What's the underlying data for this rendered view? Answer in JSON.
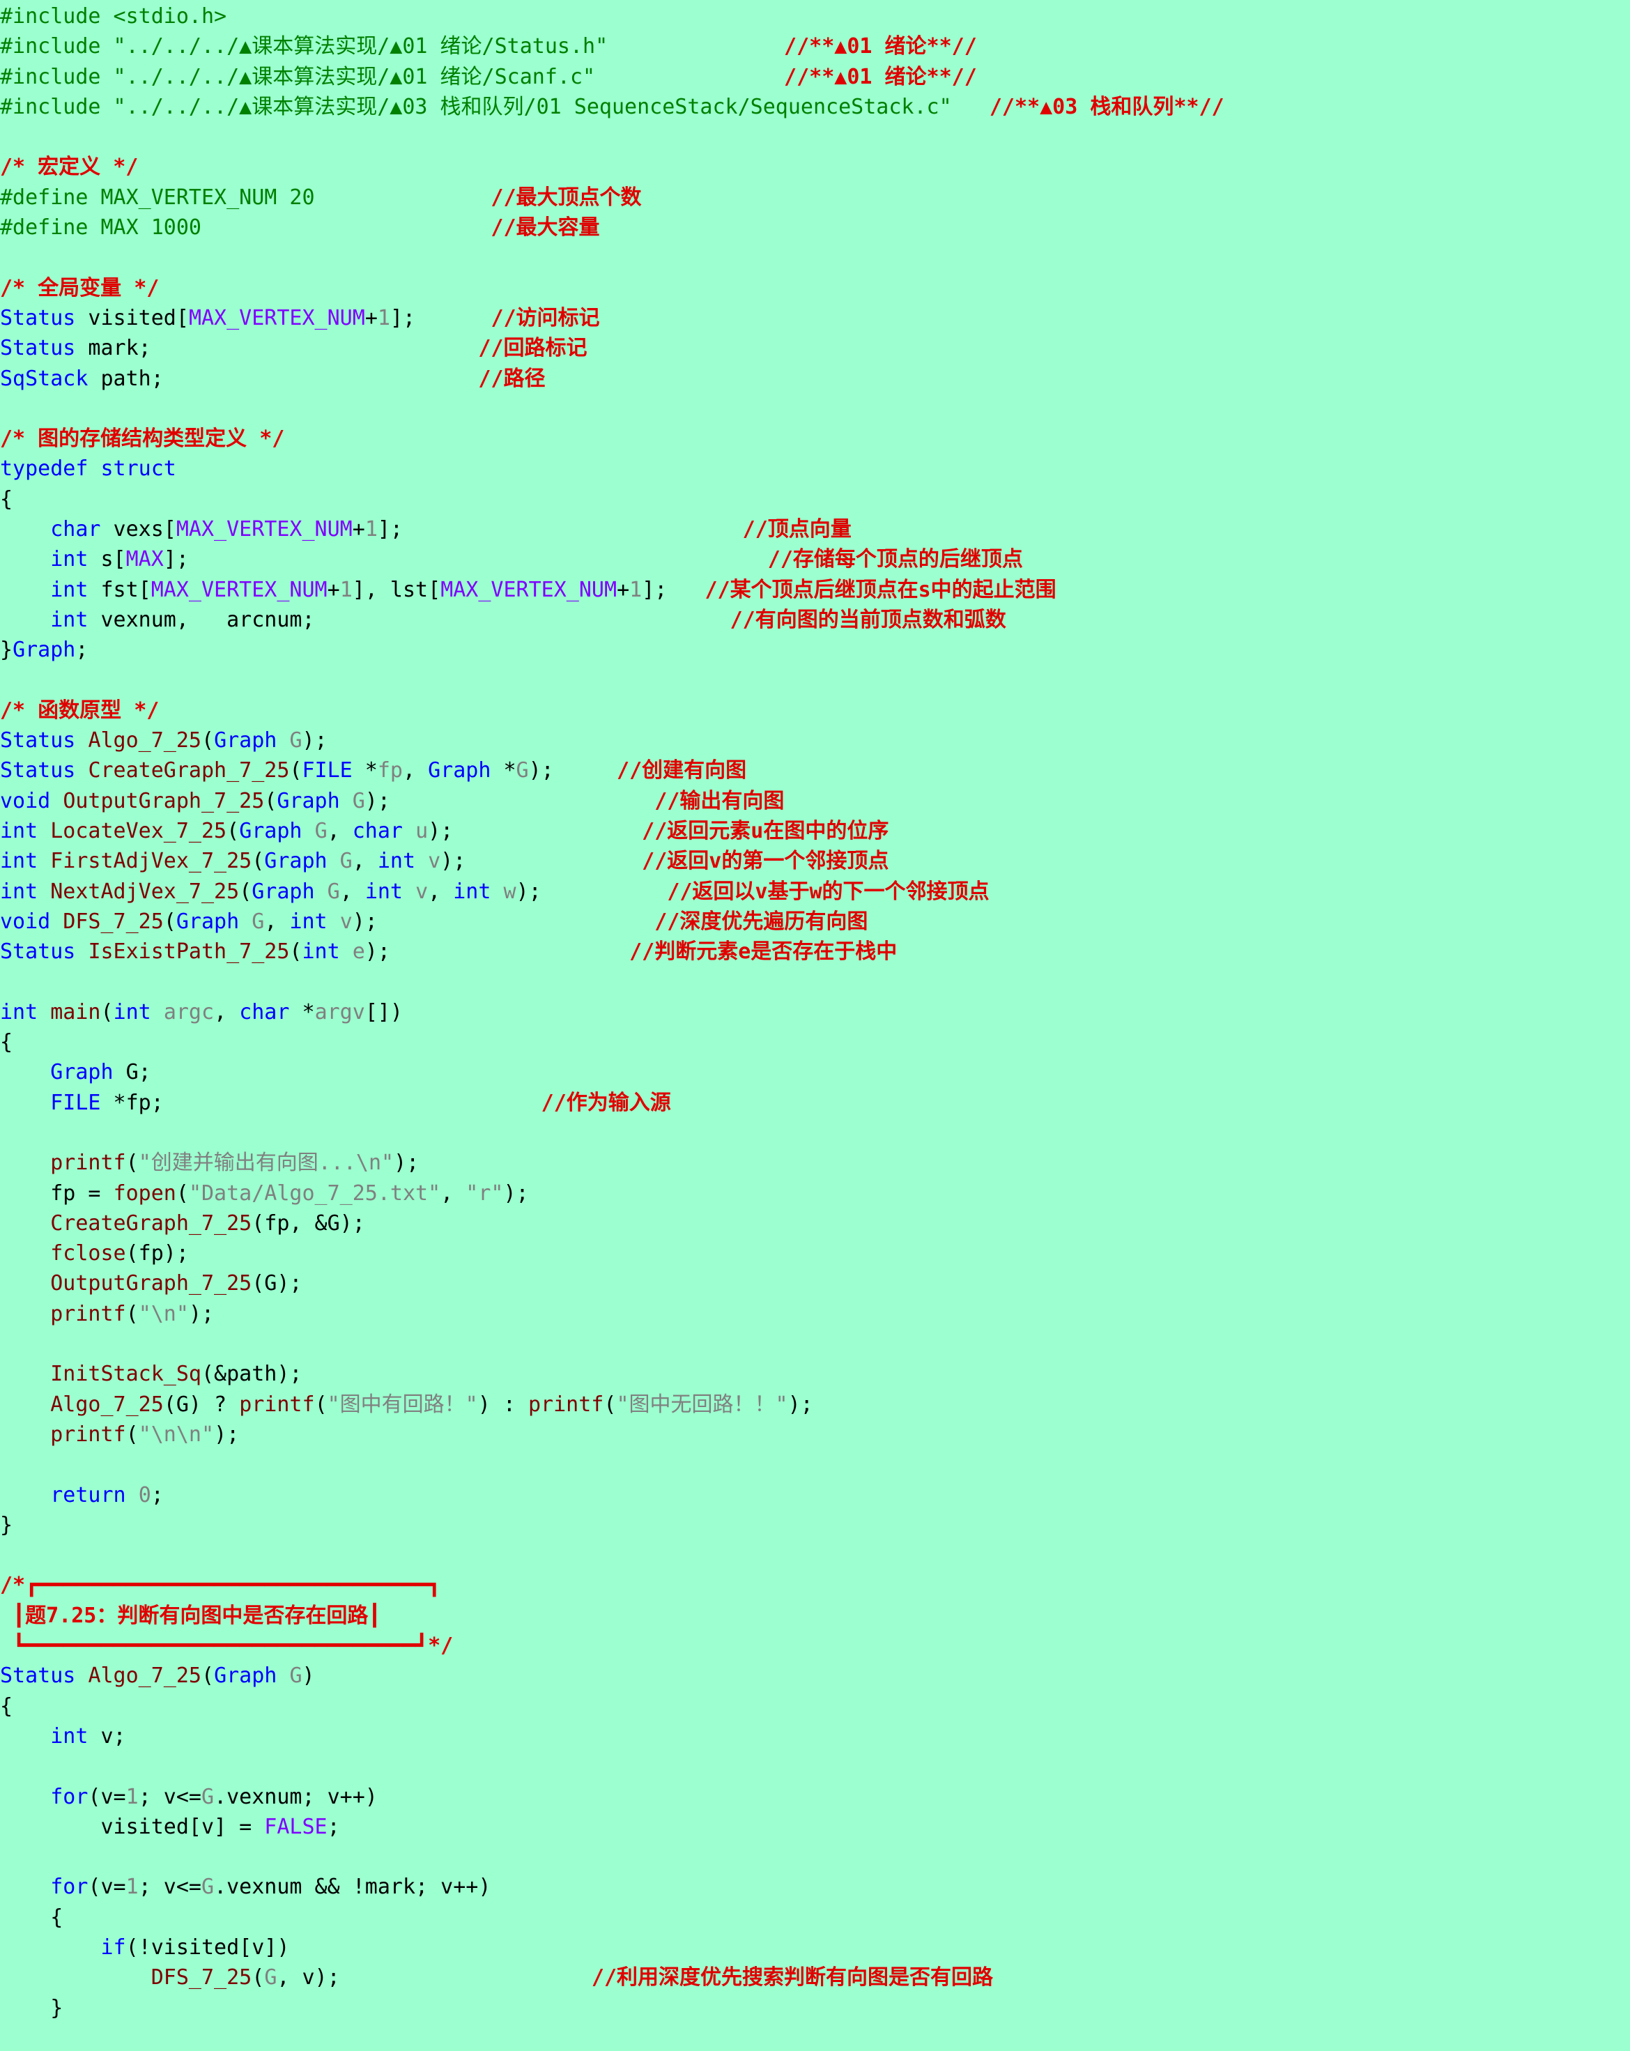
{
  "editor": {
    "background": "#9bffcf",
    "colors": {
      "plain": "#000000",
      "preprocessor": "#008000",
      "string": "#808080",
      "comment": "#e00000",
      "keyword": "#0000ff",
      "function": "#800000",
      "macro": "#8000ff",
      "number": "#808080"
    },
    "lines": [
      [
        [
          "pp",
          "#include <stdio.h>"
        ]
      ],
      [
        [
          "pp",
          "#include \"../../../▲课本算法实现/▲01 绪论/Status.h\""
        ],
        [
          "pl",
          "              "
        ],
        [
          "com",
          "//**▲01 绪论**//"
        ]
      ],
      [
        [
          "pp",
          "#include \"../../../▲课本算法实现/▲01 绪论/Scanf.c\""
        ],
        [
          "pl",
          "               "
        ],
        [
          "com",
          "//**▲01 绪论**//"
        ]
      ],
      [
        [
          "pp",
          "#include \"../../../▲课本算法实现/▲03 栈和队列/01 SequenceStack/SequenceStack.c\""
        ],
        [
          "pl",
          "   "
        ],
        [
          "com",
          "//**▲03 栈和队列**//"
        ]
      ],
      [],
      [
        [
          "com",
          "/* 宏定义 */"
        ]
      ],
      [
        [
          "pp",
          "#define MAX_VERTEX_NUM 20"
        ],
        [
          "pl",
          "              "
        ],
        [
          "com",
          "//最大顶点个数"
        ]
      ],
      [
        [
          "pp",
          "#define MAX 1000"
        ],
        [
          "pl",
          "                       "
        ],
        [
          "com",
          "//最大容量"
        ]
      ],
      [],
      [
        [
          "com",
          "/* 全局变量 */"
        ]
      ],
      [
        [
          "ty",
          "Status"
        ],
        [
          "pl",
          " visited["
        ],
        [
          "mac",
          "MAX_VERTEX_NUM"
        ],
        [
          "pl",
          "+"
        ],
        [
          "num",
          "1"
        ],
        [
          "pl",
          "];      "
        ],
        [
          "com",
          "//访问标记"
        ]
      ],
      [
        [
          "ty",
          "Status"
        ],
        [
          "pl",
          " mark;                          "
        ],
        [
          "com",
          "//回路标记"
        ]
      ],
      [
        [
          "ty",
          "SqStack"
        ],
        [
          "pl",
          " path;                         "
        ],
        [
          "com",
          "//路径"
        ]
      ],
      [],
      [
        [
          "com",
          "/* 图的存储结构类型定义 */"
        ]
      ],
      [
        [
          "kw",
          "typedef struct"
        ]
      ],
      [
        [
          "pl",
          "{"
        ]
      ],
      [
        [
          "pl",
          "    "
        ],
        [
          "kw",
          "char"
        ],
        [
          "pl",
          " vexs["
        ],
        [
          "mac",
          "MAX_VERTEX_NUM"
        ],
        [
          "pl",
          "+"
        ],
        [
          "num",
          "1"
        ],
        [
          "pl",
          "];                           "
        ],
        [
          "com",
          "//顶点向量"
        ]
      ],
      [
        [
          "pl",
          "    "
        ],
        [
          "kw",
          "int"
        ],
        [
          "pl",
          " s["
        ],
        [
          "mac",
          "MAX"
        ],
        [
          "pl",
          "];                                              "
        ],
        [
          "com",
          "//存储每个顶点的后继顶点"
        ]
      ],
      [
        [
          "pl",
          "    "
        ],
        [
          "kw",
          "int"
        ],
        [
          "pl",
          " fst["
        ],
        [
          "mac",
          "MAX_VERTEX_NUM"
        ],
        [
          "pl",
          "+"
        ],
        [
          "num",
          "1"
        ],
        [
          "pl",
          "], lst["
        ],
        [
          "mac",
          "MAX_VERTEX_NUM"
        ],
        [
          "pl",
          "+"
        ],
        [
          "num",
          "1"
        ],
        [
          "pl",
          "];   "
        ],
        [
          "com",
          "//某个顶点后继顶点在s中的起止范围"
        ]
      ],
      [
        [
          "pl",
          "    "
        ],
        [
          "kw",
          "int"
        ],
        [
          "pl",
          " vexnum,   arcnum;                                 "
        ],
        [
          "com",
          "//有向图的当前顶点数和弧数"
        ]
      ],
      [
        [
          "pl",
          "}"
        ],
        [
          "ty",
          "Graph"
        ],
        [
          "pl",
          ";"
        ]
      ],
      [],
      [
        [
          "com",
          "/* 函数原型 */"
        ]
      ],
      [
        [
          "ty",
          "Status"
        ],
        [
          "pl",
          " "
        ],
        [
          "fn",
          "Algo_7_25"
        ],
        [
          "pl",
          "("
        ],
        [
          "ty",
          "Graph"
        ],
        [
          "pl",
          " "
        ],
        [
          "par",
          "G"
        ],
        [
          "pl",
          ");"
        ]
      ],
      [
        [
          "ty",
          "Status"
        ],
        [
          "pl",
          " "
        ],
        [
          "fn",
          "CreateGraph_7_25"
        ],
        [
          "pl",
          "("
        ],
        [
          "ty",
          "FILE"
        ],
        [
          "pl",
          " *"
        ],
        [
          "par",
          "fp"
        ],
        [
          "pl",
          ", "
        ],
        [
          "ty",
          "Graph"
        ],
        [
          "pl",
          " *"
        ],
        [
          "par",
          "G"
        ],
        [
          "pl",
          ");     "
        ],
        [
          "com",
          "//创建有向图"
        ]
      ],
      [
        [
          "kw",
          "void"
        ],
        [
          "pl",
          " "
        ],
        [
          "fn",
          "OutputGraph_7_25"
        ],
        [
          "pl",
          "("
        ],
        [
          "ty",
          "Graph"
        ],
        [
          "pl",
          " "
        ],
        [
          "par",
          "G"
        ],
        [
          "pl",
          ");                     "
        ],
        [
          "com",
          "//输出有向图"
        ]
      ],
      [
        [
          "kw",
          "int"
        ],
        [
          "pl",
          " "
        ],
        [
          "fn",
          "LocateVex_7_25"
        ],
        [
          "pl",
          "("
        ],
        [
          "ty",
          "Graph"
        ],
        [
          "pl",
          " "
        ],
        [
          "par",
          "G"
        ],
        [
          "pl",
          ", "
        ],
        [
          "kw",
          "char"
        ],
        [
          "pl",
          " "
        ],
        [
          "par",
          "u"
        ],
        [
          "pl",
          ");               "
        ],
        [
          "com",
          "//返回元素u在图中的位序"
        ]
      ],
      [
        [
          "kw",
          "int"
        ],
        [
          "pl",
          " "
        ],
        [
          "fn",
          "FirstAdjVex_7_25"
        ],
        [
          "pl",
          "("
        ],
        [
          "ty",
          "Graph"
        ],
        [
          "pl",
          " "
        ],
        [
          "par",
          "G"
        ],
        [
          "pl",
          ", "
        ],
        [
          "kw",
          "int"
        ],
        [
          "pl",
          " "
        ],
        [
          "par",
          "v"
        ],
        [
          "pl",
          ");              "
        ],
        [
          "com",
          "//返回v的第一个邻接顶点"
        ]
      ],
      [
        [
          "kw",
          "int"
        ],
        [
          "pl",
          " "
        ],
        [
          "fn",
          "NextAdjVex_7_25"
        ],
        [
          "pl",
          "("
        ],
        [
          "ty",
          "Graph"
        ],
        [
          "pl",
          " "
        ],
        [
          "par",
          "G"
        ],
        [
          "pl",
          ", "
        ],
        [
          "kw",
          "int"
        ],
        [
          "pl",
          " "
        ],
        [
          "par",
          "v"
        ],
        [
          "pl",
          ", "
        ],
        [
          "kw",
          "int"
        ],
        [
          "pl",
          " "
        ],
        [
          "par",
          "w"
        ],
        [
          "pl",
          ");          "
        ],
        [
          "com",
          "//返回以v基于w的下一个邻接顶点"
        ]
      ],
      [
        [
          "kw",
          "void"
        ],
        [
          "pl",
          " "
        ],
        [
          "fn",
          "DFS_7_25"
        ],
        [
          "pl",
          "("
        ],
        [
          "ty",
          "Graph"
        ],
        [
          "pl",
          " "
        ],
        [
          "par",
          "G"
        ],
        [
          "pl",
          ", "
        ],
        [
          "kw",
          "int"
        ],
        [
          "pl",
          " "
        ],
        [
          "par",
          "v"
        ],
        [
          "pl",
          ");                      "
        ],
        [
          "com",
          "//深度优先遍历有向图"
        ]
      ],
      [
        [
          "ty",
          "Status"
        ],
        [
          "pl",
          " "
        ],
        [
          "fn",
          "IsExistPath_7_25"
        ],
        [
          "pl",
          "("
        ],
        [
          "kw",
          "int"
        ],
        [
          "pl",
          " "
        ],
        [
          "par",
          "e"
        ],
        [
          "pl",
          ");                   "
        ],
        [
          "com",
          "//判断元素e是否存在于栈中"
        ]
      ],
      [],
      [
        [
          "kw",
          "int"
        ],
        [
          "pl",
          " "
        ],
        [
          "fn",
          "main"
        ],
        [
          "pl",
          "("
        ],
        [
          "kw",
          "int"
        ],
        [
          "pl",
          " "
        ],
        [
          "par",
          "argc"
        ],
        [
          "pl",
          ", "
        ],
        [
          "kw",
          "char"
        ],
        [
          "pl",
          " *"
        ],
        [
          "par",
          "argv"
        ],
        [
          "pl",
          "[])"
        ]
      ],
      [
        [
          "pl",
          "{"
        ]
      ],
      [
        [
          "pl",
          "    "
        ],
        [
          "ty",
          "Graph"
        ],
        [
          "pl",
          " G;"
        ]
      ],
      [
        [
          "pl",
          "    "
        ],
        [
          "ty",
          "FILE"
        ],
        [
          "pl",
          " *fp;                              "
        ],
        [
          "com",
          "//作为输入源"
        ]
      ],
      [],
      [
        [
          "pl",
          "    "
        ],
        [
          "fn",
          "printf"
        ],
        [
          "pl",
          "("
        ],
        [
          "str",
          "\"创建并输出有向图...\\n\""
        ],
        [
          "pl",
          ");"
        ]
      ],
      [
        [
          "pl",
          "    fp = "
        ],
        [
          "fn",
          "fopen"
        ],
        [
          "pl",
          "("
        ],
        [
          "str",
          "\"Data/Algo_7_25.txt\""
        ],
        [
          "pl",
          ", "
        ],
        [
          "str",
          "\"r\""
        ],
        [
          "pl",
          ");"
        ]
      ],
      [
        [
          "pl",
          "    "
        ],
        [
          "fn",
          "CreateGraph_7_25"
        ],
        [
          "pl",
          "(fp, &G);"
        ]
      ],
      [
        [
          "pl",
          "    "
        ],
        [
          "fn",
          "fclose"
        ],
        [
          "pl",
          "(fp);"
        ]
      ],
      [
        [
          "pl",
          "    "
        ],
        [
          "fn",
          "OutputGraph_7_25"
        ],
        [
          "pl",
          "(G);"
        ]
      ],
      [
        [
          "pl",
          "    "
        ],
        [
          "fn",
          "printf"
        ],
        [
          "pl",
          "("
        ],
        [
          "str",
          "\"\\n\""
        ],
        [
          "pl",
          ");"
        ]
      ],
      [],
      [
        [
          "pl",
          "    "
        ],
        [
          "fn",
          "InitStack_Sq"
        ],
        [
          "pl",
          "(&path);"
        ]
      ],
      [
        [
          "pl",
          "    "
        ],
        [
          "fn",
          "Algo_7_25"
        ],
        [
          "pl",
          "(G) ? "
        ],
        [
          "fn",
          "printf"
        ],
        [
          "pl",
          "("
        ],
        [
          "str",
          "\"图中有回路！\""
        ],
        [
          "pl",
          ") : "
        ],
        [
          "fn",
          "printf"
        ],
        [
          "pl",
          "("
        ],
        [
          "str",
          "\"图中无回路！！\""
        ],
        [
          "pl",
          ");"
        ]
      ],
      [
        [
          "pl",
          "    "
        ],
        [
          "fn",
          "printf"
        ],
        [
          "pl",
          "("
        ],
        [
          "str",
          "\"\\n\\n\""
        ],
        [
          "pl",
          ");"
        ]
      ],
      [],
      [
        [
          "pl",
          "    "
        ],
        [
          "kw",
          "return"
        ],
        [
          "pl",
          " "
        ],
        [
          "num",
          "0"
        ],
        [
          "pl",
          ";"
        ]
      ],
      [
        [
          "pl",
          "}"
        ]
      ],
      [],
      [
        [
          "box",
          "/*┏━━━━━━━━━━━━━━━━━━━━━━━━━━━━━━━┓"
        ]
      ],
      [
        [
          "box",
          " ┃题7.25：判断有向图中是否存在回路┃"
        ]
      ],
      [
        [
          "box",
          " ┗━━━━━━━━━━━━━━━━━━━━━━━━━━━━━━━┛*/"
        ]
      ],
      [
        [
          "ty",
          "Status"
        ],
        [
          "pl",
          " "
        ],
        [
          "fn",
          "Algo_7_25"
        ],
        [
          "pl",
          "("
        ],
        [
          "ty",
          "Graph"
        ],
        [
          "pl",
          " "
        ],
        [
          "par",
          "G"
        ],
        [
          "pl",
          ")"
        ]
      ],
      [
        [
          "pl",
          "{"
        ]
      ],
      [
        [
          "pl",
          "    "
        ],
        [
          "kw",
          "int"
        ],
        [
          "pl",
          " v;"
        ]
      ],
      [],
      [
        [
          "pl",
          "    "
        ],
        [
          "kw",
          "for"
        ],
        [
          "pl",
          "(v="
        ],
        [
          "num",
          "1"
        ],
        [
          "pl",
          "; v<="
        ],
        [
          "par",
          "G"
        ],
        [
          "pl",
          ".vexnum; v++)"
        ]
      ],
      [
        [
          "pl",
          "        visited[v] = "
        ],
        [
          "mac",
          "FALSE"
        ],
        [
          "pl",
          ";"
        ]
      ],
      [],
      [
        [
          "pl",
          "    "
        ],
        [
          "kw",
          "for"
        ],
        [
          "pl",
          "(v="
        ],
        [
          "num",
          "1"
        ],
        [
          "pl",
          "; v<="
        ],
        [
          "par",
          "G"
        ],
        [
          "pl",
          ".vexnum && !mark; v++)"
        ]
      ],
      [
        [
          "pl",
          "    {"
        ]
      ],
      [
        [
          "pl",
          "        "
        ],
        [
          "kw",
          "if"
        ],
        [
          "pl",
          "(!visited[v])"
        ]
      ],
      [
        [
          "pl",
          "            "
        ],
        [
          "fn",
          "DFS_7_25"
        ],
        [
          "pl",
          "("
        ],
        [
          "par",
          "G"
        ],
        [
          "pl",
          ", v);                    "
        ],
        [
          "com",
          "//利用深度优先搜索判断有向图是否有回路"
        ]
      ],
      [
        [
          "pl",
          "    }"
        ]
      ]
    ]
  }
}
